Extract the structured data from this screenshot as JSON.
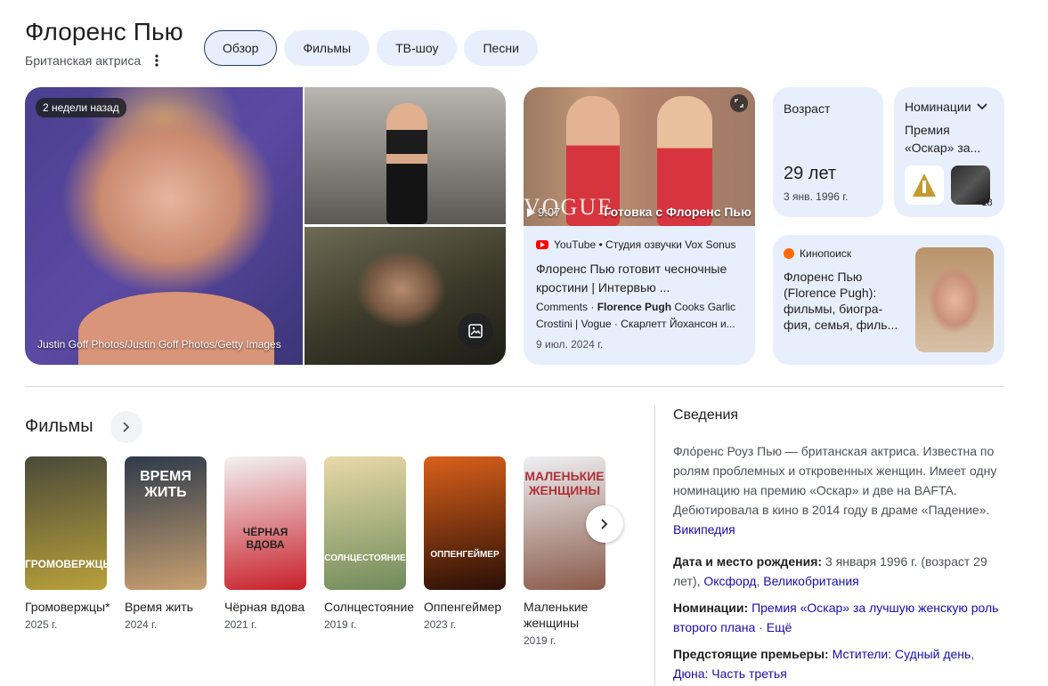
{
  "header": {
    "title": "Флоренс Пью",
    "subtitle": "Британская актриса",
    "tabs": [
      {
        "label": "Обзор",
        "active": true
      },
      {
        "label": "Фильмы"
      },
      {
        "label": "ТВ-шоу"
      },
      {
        "label": "Песни"
      }
    ]
  },
  "images": {
    "time_badge": "2 недели назад",
    "credit": "Justin Goff Photos/Justin Goff Photos/Getty Images"
  },
  "video": {
    "thumb_caption": "Готовка с Флоренс Пью",
    "brand_text": "VOGUE",
    "duration": "9:07",
    "source": "YouTube • Студия озвучки Vox Sonus",
    "title": "Флоренс Пью готовит чесночные кростини | Интервью ...",
    "snippet_pre": "Comments · ",
    "snippet_bold": "Florence Pugh",
    "snippet_post": " Cooks Garlic Crostini | Vogue · Скарлетт Йохансон и...",
    "date": "9 июл. 2024 г."
  },
  "age": {
    "label": "Возраст",
    "value": "29 лет",
    "birth": "3 янв. 1996 г."
  },
  "nominations": {
    "label": "Номинации",
    "text": "Премия «Оскар» за...",
    "more": "+18"
  },
  "kinopoisk": {
    "source": "Кинопоиск",
    "title": "Флоренс Пью (Florence Pugh): фильмы, биогра-фия, семья, филь..."
  },
  "films": {
    "title": "Фильмы",
    "items": [
      {
        "name": "Громовержцы*",
        "year": "2025 г.",
        "poster_text": "ГРОМОВЕРЖЦЫ",
        "color1": "#4a4a3a",
        "color2": "#b8a03a"
      },
      {
        "name": "Время жить",
        "year": "2024 г.",
        "poster_text": "ВРЕМЯ ЖИТЬ",
        "color1": "#2e3a4a",
        "color2": "#c8a070"
      },
      {
        "name": "Чёрная вдова",
        "year": "2021 г.",
        "poster_text": "ЧЁРНАЯ ВДОВА",
        "color1": "#f2f2f2",
        "color2": "#c8202a"
      },
      {
        "name": "Солнцестояние",
        "year": "2019 г.",
        "poster_text": "СОЛНЦЕСТОЯНИЕ",
        "color1": "#e9d9a8",
        "color2": "#6f8c5a"
      },
      {
        "name": "Оппенгеймер",
        "year": "2023 г.",
        "poster_text": "ОППЕНГЕЙМЕР",
        "color1": "#d9601a",
        "color2": "#2a0f06"
      },
      {
        "name": "Маленькие женщины",
        "year": "2019 г.",
        "poster_text": "МАЛЕНЬКИЕ ЖЕНЩИНЫ",
        "color1": "#eef0f2",
        "color2": "#8a5a4a"
      }
    ]
  },
  "about": {
    "title": "Сведения",
    "description": "Фло́ренс Роуз Пью — британская актриса. Известна по ролям проблемных и откровенных женщин. Имеет одну номинацию на премию «Оскар» и две на BAFTA. Дебютировала в кино в 2014 году в драме «Падение».",
    "source_link": "Википедия",
    "birth_label": "Дата и место рождения:",
    "birth_value": " 3 января 1996 г. (возраст 29 лет), ",
    "birth_place1": "Оксфорд",
    "birth_place2": "Великобритания",
    "nominations_label": "Номинации:",
    "nominations_value": "Премия «Оскар» за лучшую женскую роль второго плана",
    "nominations_more": "Ещё",
    "upcoming_label": "Предстоящие премьеры:",
    "upcoming1": "Мстители: Судный день",
    "upcoming2": "Дюна: Часть третья"
  }
}
